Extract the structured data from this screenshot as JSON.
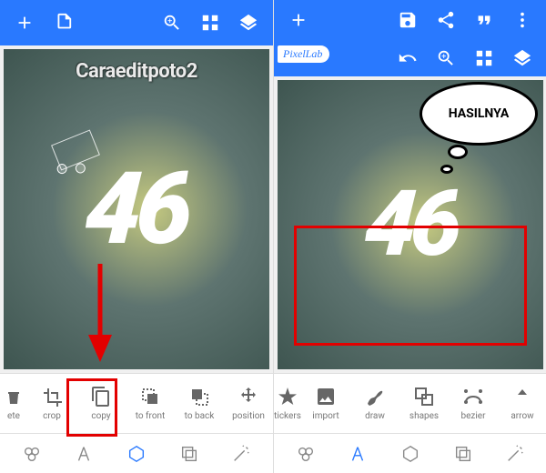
{
  "left": {
    "watermark": "Caraeditpoto2",
    "canvas_text": "46",
    "toolbar": [
      {
        "key": "delete",
        "label": "ete"
      },
      {
        "key": "crop",
        "label": "crop"
      },
      {
        "key": "copy",
        "label": "copy"
      },
      {
        "key": "tofront",
        "label": "to front"
      },
      {
        "key": "toback",
        "label": "to back"
      },
      {
        "key": "position",
        "label": "position"
      }
    ]
  },
  "right": {
    "logo": "PixelLab",
    "speech": "HASILNYA",
    "canvas_text": "46",
    "toolbar": [
      {
        "key": "stickers",
        "label": "tickers"
      },
      {
        "key": "import",
        "label": "import"
      },
      {
        "key": "draw",
        "label": "draw"
      },
      {
        "key": "shapes",
        "label": "shapes"
      },
      {
        "key": "bezier",
        "label": "bezier"
      },
      {
        "key": "arrow",
        "label": "arrow"
      }
    ]
  }
}
